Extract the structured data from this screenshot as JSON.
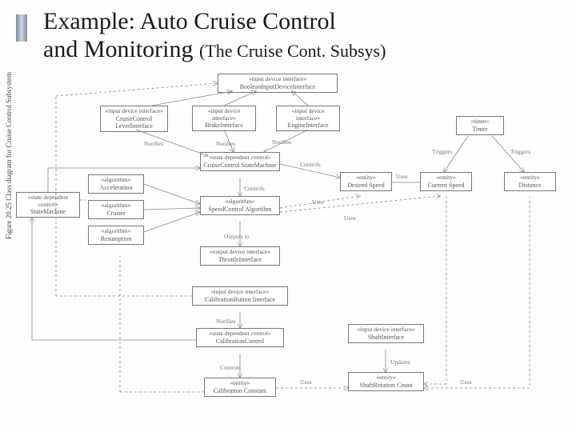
{
  "title": {
    "line1": "Example: Auto Cruise Control",
    "line2_main": "and Monitoring ",
    "line2_sub": "(The Cruise Cont. Subsys)"
  },
  "figure_label": "Figure 20.25   Class diagram for Cruise Control Subsystem",
  "boxes": {
    "boolInput": {
      "stereo": "«input device interface»",
      "name": "BooleanInputDeviceInterface"
    },
    "lever": {
      "stereo": "«input device interface»",
      "name": "CruiseControl LeverInterface"
    },
    "brake": {
      "stereo": "«input device interface»",
      "name": "BrakeInterface"
    },
    "engine": {
      "stereo": "«input device interface»",
      "name": "EngineInterface"
    },
    "ccsm": {
      "stereo": "«state dependent control»",
      "name": "CruiseControl StateMachine"
    },
    "accel": {
      "stereo": "«algorithm»",
      "name": "Acceleration"
    },
    "cruiser": {
      "stereo": "«algorithm»",
      "name": "Cruiser"
    },
    "resume": {
      "stereo": "«algorithm»",
      "name": "Resumption"
    },
    "scAlg": {
      "stereo": "«algorithm»",
      "name": "SpeedControl Algorithm"
    },
    "stateMach": {
      "stereo": "«state dependent control»",
      "name": "StateMachine"
    },
    "throttle": {
      "stereo": "«output device interface»",
      "name": "ThrottleInterface"
    },
    "desired": {
      "stereo": "«entity»",
      "name": "Desired Speed"
    },
    "current": {
      "stereo": "«entity»",
      "name": "Current Speed"
    },
    "distance": {
      "stereo": "«entity»",
      "name": "Distance"
    },
    "timer": {
      "stereo": "«timer»",
      "name": "Timer"
    },
    "calibBtn": {
      "stereo": "«input device interface»",
      "name": "CalibrationButton Interface"
    },
    "calibCtrl": {
      "stereo": "«state dependent control»",
      "name": "CalibrationControl"
    },
    "calibConst": {
      "stereo": "«entity»",
      "name": "Calibration Constant"
    },
    "shaftIntf": {
      "stereo": "«input device interface»",
      "name": "ShaftInterface"
    },
    "shaftCount": {
      "stereo": "«entity»",
      "name": "ShaftRotation Count"
    }
  },
  "labels": {
    "notifies": "Notifies",
    "controls": "Controls",
    "uses": "Uses",
    "outputs": "Outputs to",
    "updates": "Updates",
    "triggers": "Triggers"
  }
}
